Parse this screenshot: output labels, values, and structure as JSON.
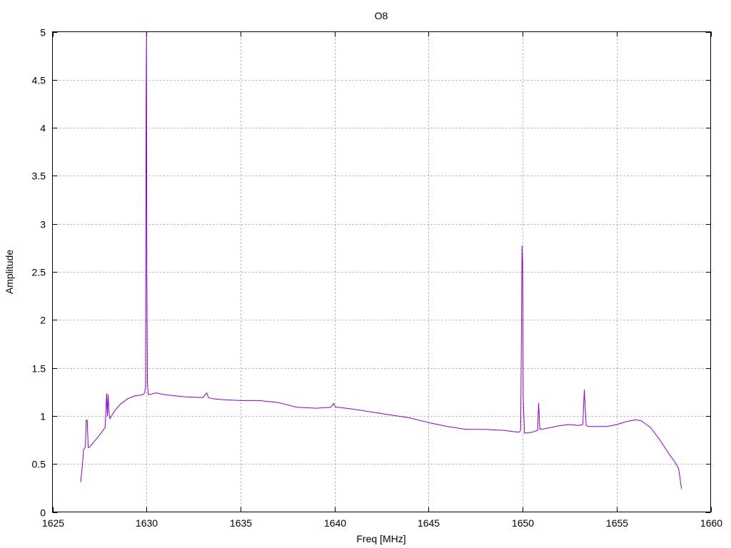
{
  "chart_data": {
    "type": "line",
    "title": "O8",
    "xlabel": "Freq [MHz]",
    "ylabel": "Amplitude",
    "xlim": [
      1625,
      1660
    ],
    "ylim": [
      0,
      5
    ],
    "xticks": [
      1625,
      1630,
      1635,
      1640,
      1645,
      1650,
      1655,
      1660
    ],
    "yticks": [
      0,
      0.5,
      1,
      1.5,
      2,
      2.5,
      3,
      3.5,
      4,
      4.5,
      5
    ],
    "xtick_labels": [
      "1625",
      "1630",
      "1635",
      "1640",
      "1645",
      "1650",
      "1655",
      "1660"
    ],
    "ytick_labels": [
      "0",
      "0.5",
      "1",
      "1.5",
      "2",
      "2.5",
      "3",
      "3.5",
      "4",
      "4.5",
      "5"
    ],
    "grid": true,
    "colors": {
      "series": "#8a00d4"
    },
    "series": [
      {
        "x": [
          1626.5,
          1626.6,
          1626.65,
          1626.7,
          1626.75,
          1626.8,
          1626.85,
          1626.9,
          1627.0,
          1627.2,
          1627.5,
          1627.8,
          1627.88,
          1627.92,
          1627.96,
          1628.0,
          1628.05,
          1628.3,
          1628.6,
          1629.0,
          1629.4,
          1629.8,
          1629.9,
          1629.95,
          1629.98,
          1630.0,
          1630.02,
          1630.05,
          1630.1,
          1630.5,
          1631.0,
          1632.0,
          1633.0,
          1633.2,
          1633.3,
          1633.5,
          1634.0,
          1635.0,
          1636.0,
          1637.0,
          1638.0,
          1639.0,
          1639.8,
          1639.95,
          1640.05,
          1640.2,
          1641.0,
          1642.0,
          1643.0,
          1644.0,
          1645.0,
          1646.0,
          1647.0,
          1648.0,
          1649.0,
          1649.8,
          1649.9,
          1649.97,
          1650.0,
          1650.03,
          1650.1,
          1650.5,
          1650.8,
          1650.85,
          1650.92,
          1651.0,
          1651.5,
          1652.0,
          1652.5,
          1653.0,
          1653.2,
          1653.28,
          1653.32,
          1653.38,
          1653.5,
          1654.0,
          1654.5,
          1655.0,
          1655.5,
          1656.0,
          1656.3,
          1656.8,
          1657.3,
          1657.8,
          1658.1,
          1658.3,
          1658.45
        ],
        "y": [
          0.31,
          0.5,
          0.65,
          0.66,
          0.68,
          0.96,
          0.95,
          0.67,
          0.68,
          0.73,
          0.8,
          0.88,
          1.23,
          1.0,
          1.22,
          1.05,
          0.97,
          1.05,
          1.12,
          1.18,
          1.21,
          1.22,
          1.24,
          1.3,
          4.3,
          5.0,
          2.5,
          1.35,
          1.22,
          1.24,
          1.22,
          1.2,
          1.19,
          1.24,
          1.19,
          1.18,
          1.17,
          1.16,
          1.16,
          1.14,
          1.09,
          1.08,
          1.09,
          1.13,
          1.09,
          1.09,
          1.07,
          1.04,
          1.01,
          0.98,
          0.93,
          0.89,
          0.86,
          0.86,
          0.85,
          0.83,
          0.85,
          2.77,
          2.6,
          1.2,
          0.82,
          0.83,
          0.85,
          1.13,
          0.86,
          0.86,
          0.88,
          0.9,
          0.91,
          0.9,
          0.91,
          1.27,
          1.12,
          0.9,
          0.89,
          0.89,
          0.89,
          0.91,
          0.94,
          0.96,
          0.95,
          0.88,
          0.75,
          0.6,
          0.52,
          0.45,
          0.24
        ]
      }
    ]
  }
}
